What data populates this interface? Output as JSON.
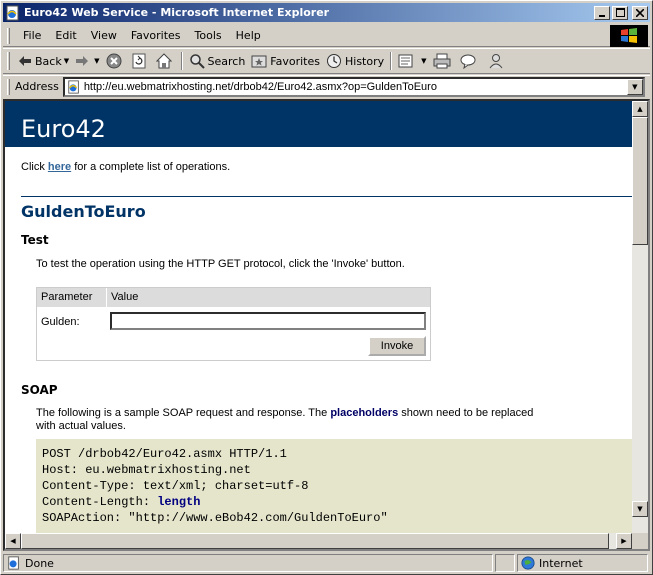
{
  "window": {
    "title": "Euro42 Web Service - Microsoft Internet Explorer"
  },
  "menu": [
    "File",
    "Edit",
    "View",
    "Favorites",
    "Tools",
    "Help"
  ],
  "toolbar": {
    "back": "Back",
    "search": "Search",
    "favorites": "Favorites",
    "history": "History"
  },
  "address": {
    "label": "Address",
    "url": "http://eu.webmatrixhosting.net/drbob42/Euro42.asmx?op=GuldenToEuro"
  },
  "page": {
    "service_name": "Euro42",
    "intro_prefix": "Click",
    "intro_link": "here",
    "intro_suffix": "for a complete list of operations.",
    "operation": "GuldenToEuro",
    "test": {
      "title": "Test",
      "instruction": "To test the operation using the HTTP GET protocol, click the 'Invoke' button.",
      "col_parameter": "Parameter",
      "col_value": "Value",
      "param_label": "Gulden:",
      "param_value": "",
      "invoke": "Invoke"
    },
    "soap": {
      "title": "SOAP",
      "desc_prefix": "The following is a sample SOAP request and response. The",
      "desc_bold": "placeholders",
      "desc_suffix": "shown need to be replaced",
      "desc_line2": "with actual values.",
      "lines": [
        "POST /drbob42/Euro42.asmx HTTP/1.1",
        "Host: eu.webmatrixhosting.net",
        "Content-Type: text/xml; charset=utf-8",
        "Content-Length: ",
        "SOAPAction: \"http://www.eBob42.com/GuldenToEuro\""
      ],
      "length_placeholder": "length"
    }
  },
  "status": {
    "text": "Done",
    "zone": "Internet"
  }
}
